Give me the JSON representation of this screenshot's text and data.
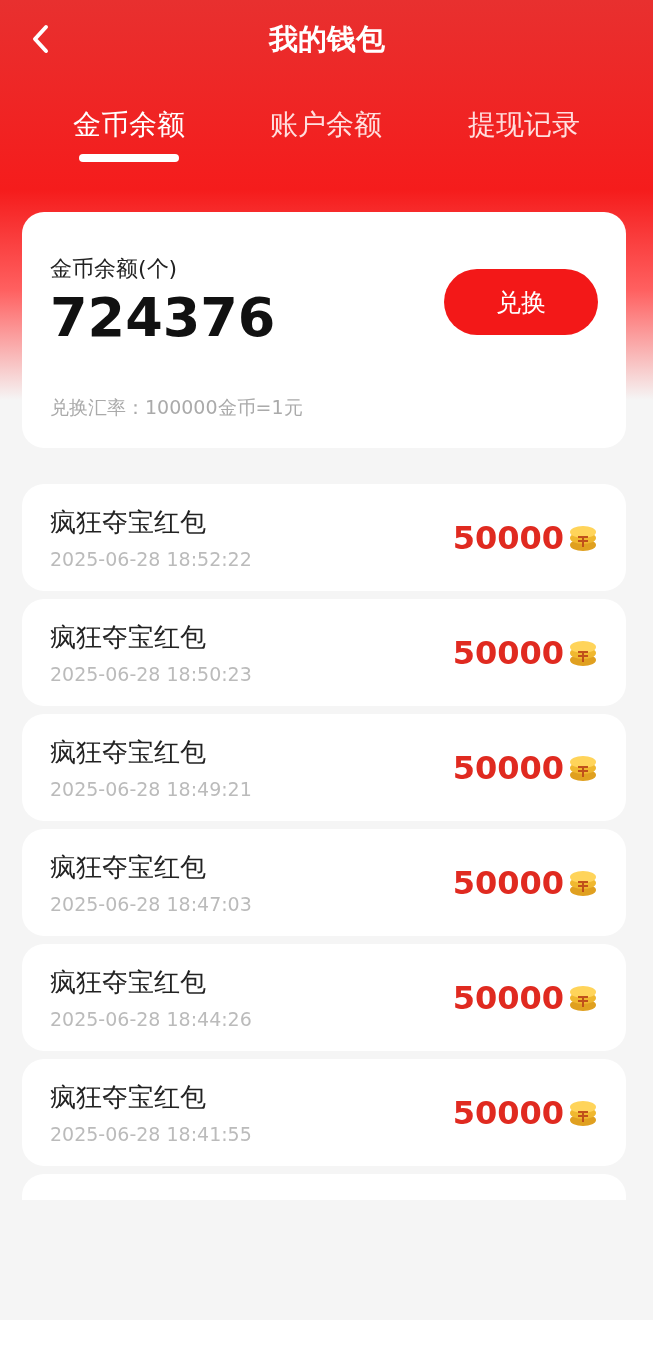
{
  "header": {
    "title": "我的钱包"
  },
  "tabs": [
    {
      "label": "金币余额",
      "selected": true
    },
    {
      "label": "账户余额",
      "selected": false
    },
    {
      "label": "提现记录",
      "selected": false
    }
  ],
  "balance_card": {
    "label": "金币余额(个)",
    "amount": "724376",
    "button": "兑换",
    "rate": "兑换汇率：100000金币=1元"
  },
  "records": [
    {
      "title": "疯狂夺宝红包",
      "time": "2025-06-28 18:52:22",
      "amount": "50000"
    },
    {
      "title": "疯狂夺宝红包",
      "time": "2025-06-28 18:50:23",
      "amount": "50000"
    },
    {
      "title": "疯狂夺宝红包",
      "time": "2025-06-28 18:49:21",
      "amount": "50000"
    },
    {
      "title": "疯狂夺宝红包",
      "time": "2025-06-28 18:47:03",
      "amount": "50000"
    },
    {
      "title": "疯狂夺宝红包",
      "time": "2025-06-28 18:44:26",
      "amount": "50000"
    },
    {
      "title": "疯狂夺宝红包",
      "time": "2025-06-28 18:41:55",
      "amount": "50000"
    }
  ]
}
